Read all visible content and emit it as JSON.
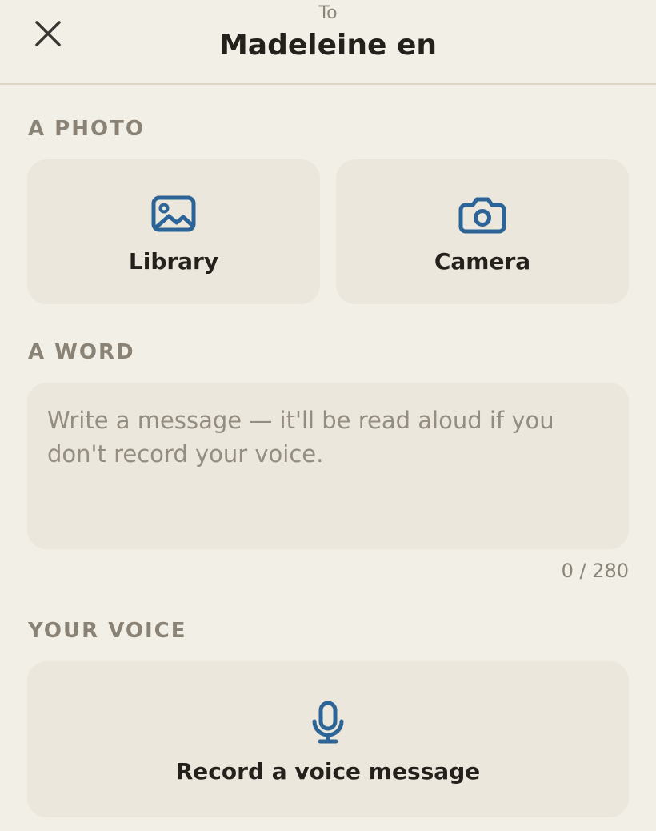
{
  "header": {
    "to_label": "To",
    "recipient_name": "Madeleine en",
    "close_icon": "close-icon"
  },
  "photo_section": {
    "label": "A PHOTO",
    "library": {
      "label": "Library",
      "icon": "image-icon"
    },
    "camera": {
      "label": "Camera",
      "icon": "camera-icon"
    }
  },
  "word_section": {
    "label": "A WORD",
    "message": {
      "value": "",
      "placeholder": "Write a message — it'll be read aloud if you don't record your voice."
    },
    "counter": "0 / 280"
  },
  "voice_section": {
    "label": "YOUR VOICE",
    "record": {
      "label": "Record a voice message",
      "icon": "microphone-icon"
    }
  },
  "colors": {
    "background": "#f2efe7",
    "tile": "#ece7dc",
    "accent_icon": "#2d6497",
    "section_label": "#8a8375"
  }
}
